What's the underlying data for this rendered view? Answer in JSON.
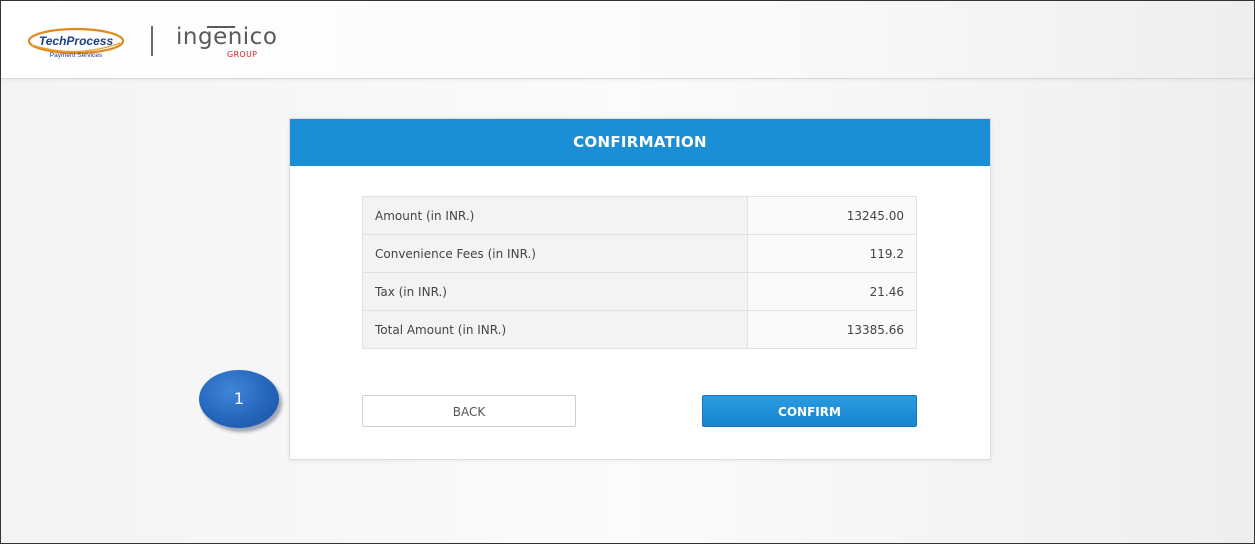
{
  "header": {
    "logo_primary": {
      "brand": "TechProcess",
      "tagline": "Payment Services"
    },
    "logo_secondary": {
      "brand": "ingenico",
      "group": "GROUP"
    }
  },
  "confirmation": {
    "title": "CONFIRMATION",
    "rows": [
      {
        "label": "Amount (in INR.)",
        "value": "13245.00"
      },
      {
        "label": "Convenience Fees (in INR.)",
        "value": "119.2"
      },
      {
        "label": "Tax (in INR.)",
        "value": "21.46"
      },
      {
        "label": "Total Amount (in INR.)",
        "value": "13385.66"
      }
    ],
    "back_label": "BACK",
    "confirm_label": "CONFIRM"
  },
  "annotation": {
    "step_number": "1",
    "left_brace": "{",
    "right_brace": "}"
  },
  "colors": {
    "header_blue": "#1b8fd6",
    "confirm_blue": "#1784cf",
    "marker_blue": "#2566bd",
    "ingenico_red": "#d2232a",
    "brace_blue": "#2a7fd0"
  }
}
